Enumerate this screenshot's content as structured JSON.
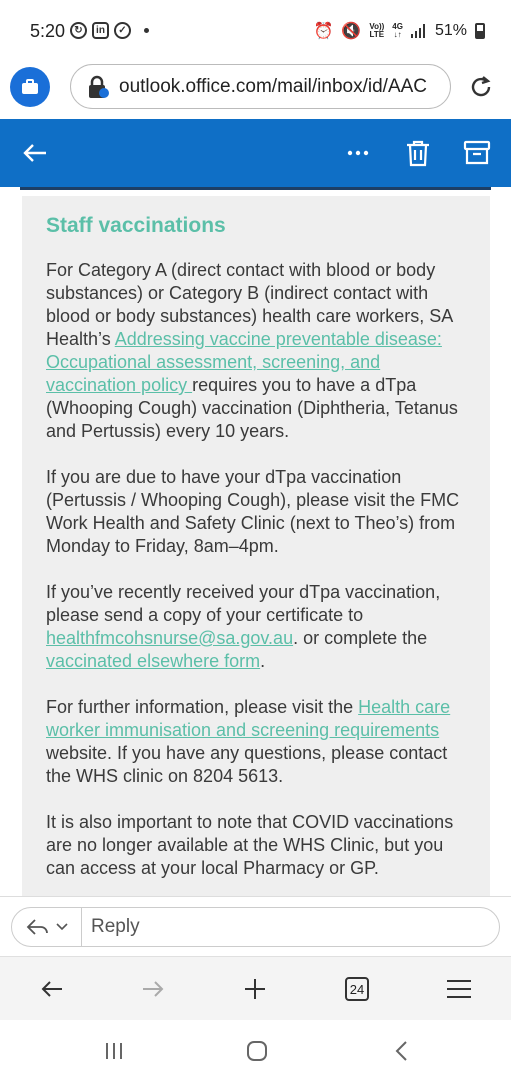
{
  "status_bar": {
    "time": "5:20",
    "battery": "51%",
    "net_top": "Vo))",
    "net_bottom": "LTE",
    "gen_top": "4G",
    "gen_bottom": "↓↑"
  },
  "browser": {
    "url": "outlook.office.com/mail/inbox/id/AAC",
    "tab_count": "24"
  },
  "email": {
    "section_title": "Staff vaccinations",
    "p1_a": "For Category A (direct contact with blood or body substances) or Category B (indirect contact with blood or body substances) health care workers, SA Health’s ",
    "p1_link": "Addressing vaccine preventable disease: Occupational assessment, screening, and vaccination policy ",
    "p1_b": "requires you to have a dTpa (Whooping Cough) vaccination (Diphtheria, Tetanus and Pertussis) every 10 years.",
    "p2": "If you are due to have your dTpa vaccination (Pertussis / Whooping Cough), please visit the FMC Work Health and Safety Clinic (next to Theo’s) from Monday to Friday, 8am–4pm.",
    "p3_a": "If you’ve recently received your dTpa vaccination, please send a copy of your certificate to ",
    "p3_email": "healthfmcohsnurse@sa.gov.au",
    "p3_b": ". or complete the ",
    "p3_link": "vaccinated elsewhere form",
    "p3_c": ".",
    "p4_a": "For further information, please visit the ",
    "p4_link": "Health care worker immunisation and screening requirements",
    "p4_b": " website. If you have any questions, please contact the WHS clinic on 8204 5613.",
    "p5": "It is also important to note that COVID vaccinations are no longer available at the WHS Clinic, but you can access at your local Pharmacy or GP."
  },
  "reply": {
    "label": "Reply"
  },
  "colors": {
    "header_blue": "#0f6fc6",
    "accent_green": "#5bbfa8",
    "card_gray": "#efefef"
  }
}
